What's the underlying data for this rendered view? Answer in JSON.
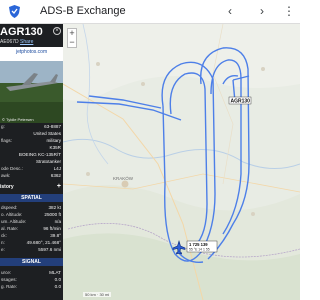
{
  "app": {
    "title": "ADS-B Exchange"
  },
  "panel": {
    "callsign": "AGR130",
    "hex_code": "AE067D",
    "share_label": "Share",
    "photo_site": "jetphotos.com",
    "photo_credit": "© Tyldle Petersen",
    "details": [
      {
        "k": "g:",
        "v": "63-8887"
      },
      {
        "k": "",
        "v": "United States"
      },
      {
        "k": "flags:",
        "v": "military"
      },
      {
        "k": "",
        "v": "K35R"
      },
      {
        "k": "",
        "v": "BOEING KC-135R/T"
      },
      {
        "k": "",
        "v": "Stratotanker"
      },
      {
        "k": "ode Desc.:",
        "v": "L4J"
      },
      {
        "k": "awk:",
        "v": "6362"
      }
    ],
    "history_label": "istory",
    "spatial_label": "SPATIAL",
    "spatial": [
      {
        "k": "dspeed:",
        "v": "382 kt"
      },
      {
        "k": "o. Altitude:",
        "v": "25000 ft"
      },
      {
        "k": "um. Altitude:",
        "v": "n/a"
      },
      {
        "k": "al. Rate:",
        "v": "96 ft/min"
      },
      {
        "k": "ck:",
        "v": "39.8°"
      },
      {
        "k": "n:",
        "v": "49.680°, 21.468°"
      },
      {
        "k": "e:",
        "v": "5597.6 nmi"
      }
    ],
    "signal_label": "SIGNAL",
    "signal": [
      {
        "k": "urce:",
        "v": "MLAT"
      },
      {
        "k": "ssages:",
        "v": "0.0"
      },
      {
        "k": "g. Rate:",
        "v": "0.0"
      }
    ]
  },
  "map": {
    "city_label": "KRAKÓW",
    "aircraft_label": "AGR130",
    "tag_lines": [
      "1 725 139",
      "55 °E 14 1 55"
    ],
    "scale_text": "50 km · 30 mi"
  },
  "colors": {
    "track": "#4d7fe8",
    "panel_bg": "#1d1f22",
    "bar": "#233f7b"
  }
}
